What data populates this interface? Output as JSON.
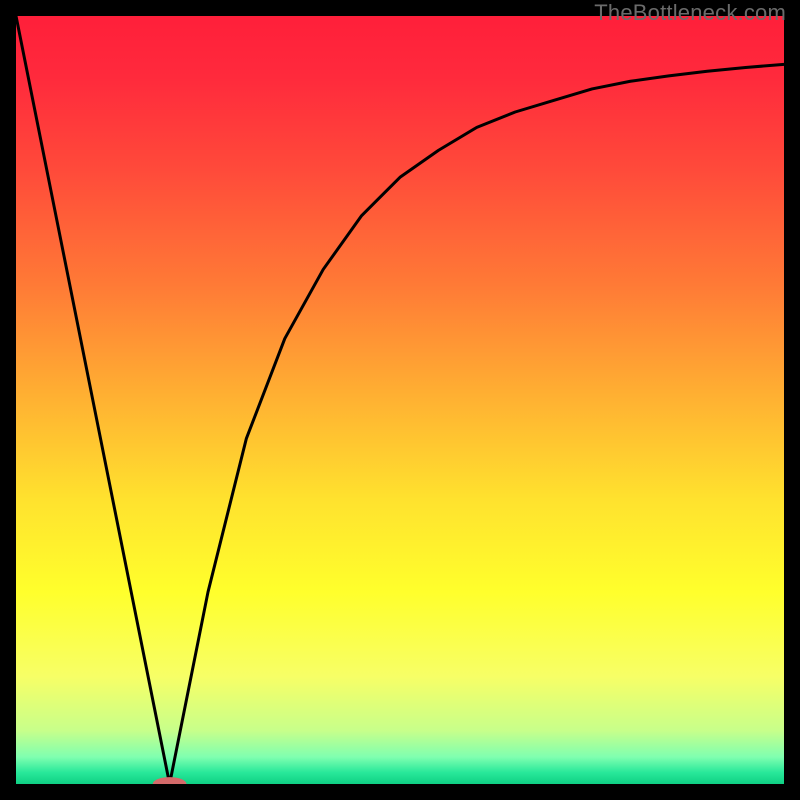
{
  "watermark": "TheBottleneck.com",
  "chart_data": {
    "type": "line",
    "title": "",
    "xlabel": "",
    "ylabel": "",
    "xlim": [
      0,
      100
    ],
    "ylim": [
      0,
      100
    ],
    "grid": false,
    "legend": false,
    "series": [
      {
        "name": "curve",
        "x": [
          0,
          5,
          10,
          15,
          18,
          20,
          22,
          25,
          30,
          35,
          40,
          45,
          50,
          55,
          60,
          65,
          70,
          75,
          80,
          85,
          90,
          95,
          100
        ],
        "y": [
          100,
          75,
          50,
          25,
          10,
          0,
          10,
          25,
          45,
          58,
          67,
          74,
          79,
          82.5,
          85.5,
          87.5,
          89,
          90.5,
          91.5,
          92.2,
          92.8,
          93.3,
          93.7
        ]
      }
    ],
    "marker": {
      "x": 20,
      "y": 0,
      "rx": 2.2,
      "ry": 0.9,
      "color": "#d46a6a"
    },
    "gradient_stops": [
      {
        "offset": 0.0,
        "color": "#ff1f3a"
      },
      {
        "offset": 0.08,
        "color": "#ff2a3c"
      },
      {
        "offset": 0.2,
        "color": "#ff4a3a"
      },
      {
        "offset": 0.35,
        "color": "#ff7a36"
      },
      {
        "offset": 0.5,
        "color": "#ffb232"
      },
      {
        "offset": 0.63,
        "color": "#ffe22e"
      },
      {
        "offset": 0.75,
        "color": "#ffff2c"
      },
      {
        "offset": 0.86,
        "color": "#f7ff66"
      },
      {
        "offset": 0.93,
        "color": "#c8ff8a"
      },
      {
        "offset": 0.965,
        "color": "#7fffb0"
      },
      {
        "offset": 0.985,
        "color": "#28e89a"
      },
      {
        "offset": 1.0,
        "color": "#0fd084"
      }
    ]
  }
}
